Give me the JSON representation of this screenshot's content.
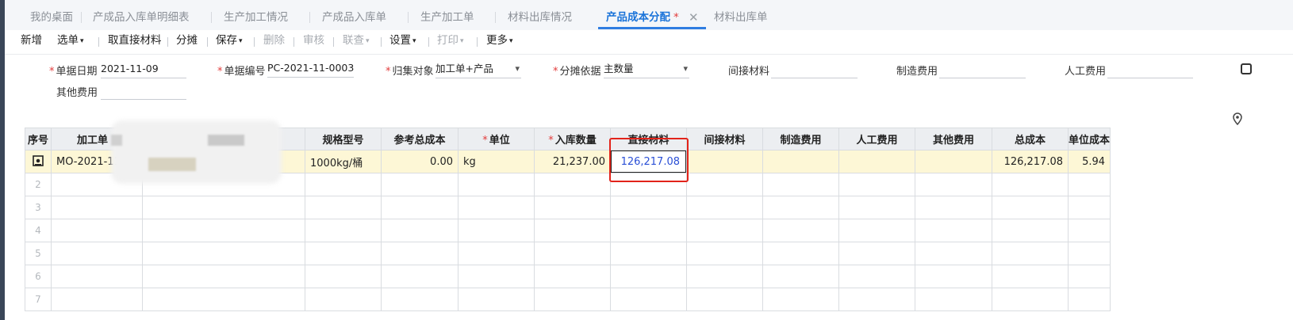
{
  "tabs": [
    {
      "label": "我的桌面"
    },
    {
      "label": "产成品入库单明细表"
    },
    {
      "label": "生产加工情况"
    },
    {
      "label": "产成品入库单"
    },
    {
      "label": "生产加工单"
    },
    {
      "label": "材料出库情况"
    },
    {
      "label": "产品成本分配",
      "active": true,
      "modified_mark": "*"
    },
    {
      "label": "材料出库单"
    }
  ],
  "toolbar": {
    "new": "新增",
    "select": "选单",
    "fetch_material": "取直接材料",
    "allocate": "分摊",
    "save": "保存",
    "delete": "删除",
    "audit": "审核",
    "link_query": "联查",
    "settings": "设置",
    "print": "打印",
    "more": "更多"
  },
  "form": {
    "date_label": "单据日期",
    "date_value": "2021-11-09",
    "number_label": "单据编号",
    "number_value": "PC-2021-11-0003",
    "collect_label": "归集对象",
    "collect_value": "加工单+产品",
    "basis_label": "分摊依据",
    "basis_value": "主数量",
    "indirect_label": "间接材料",
    "mfg_label": "制造费用",
    "labor_label": "人工费用",
    "other_label": "其他费用"
  },
  "table": {
    "headers": {
      "seq": "序号",
      "work_order": "加工单",
      "spec": "规格型号",
      "ref_cost": "参考总成本",
      "unit": "单位",
      "in_qty": "入库数量",
      "direct_material": "直接材料",
      "indirect_material": "间接材料",
      "mfg_cost": "制造费用",
      "labor_cost": "人工费用",
      "other_cost": "其他费用",
      "total_cost": "总成本",
      "unit_cost": "单位成本"
    },
    "row1": {
      "work_order": "MO-2021-11",
      "spec": "1000kg/桶",
      "ref_cost": "0.00",
      "unit": "kg",
      "in_qty": "21,237.00",
      "direct_material": "126,217.08",
      "total_cost": "126,217.08",
      "unit_cost": "5.94"
    },
    "empty_rows": [
      "2",
      "3",
      "4",
      "5",
      "6",
      "7"
    ]
  },
  "icons": [
    "gear-icon",
    "close-icon",
    "location-pin-icon",
    "camera-icon"
  ],
  "colors": {
    "accent": "#1a73d9",
    "required": "#e23b3b",
    "highlight_row": "#fdf7d6",
    "annotation_box": "#e2231a",
    "link_value": "#2a4fd6"
  }
}
